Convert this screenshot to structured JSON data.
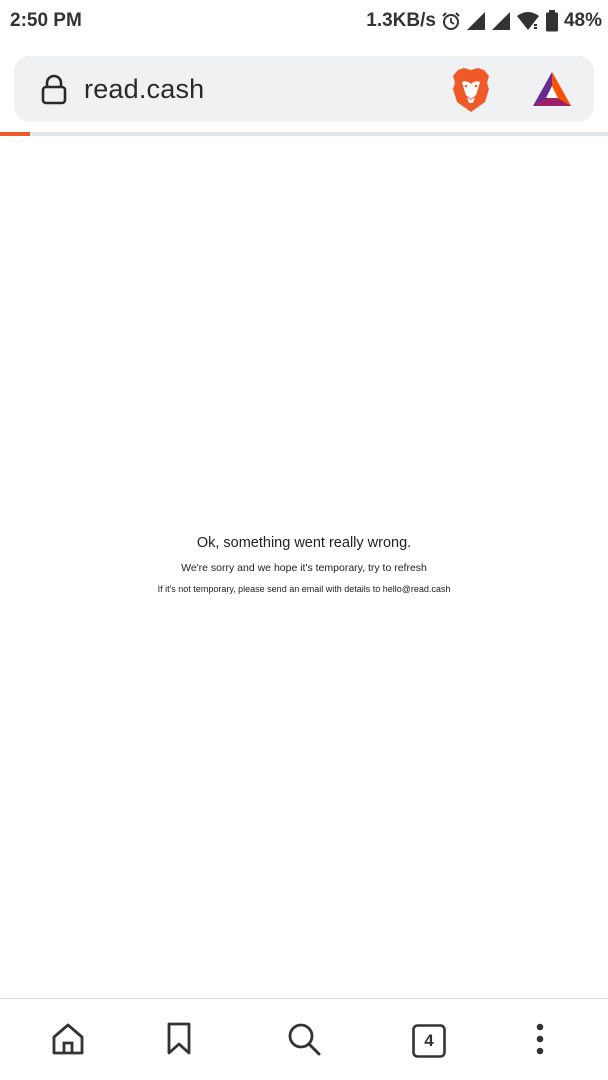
{
  "status_bar": {
    "time": "2:50 PM",
    "net_speed": "1.3KB/s",
    "battery": "48%",
    "icons": [
      "alarm-icon",
      "signal-icon",
      "signal-icon",
      "wifi-icon",
      "battery-icon"
    ]
  },
  "url_bar": {
    "url": "read.cash",
    "icons": [
      "lock-icon",
      "brave-shields-icon",
      "bat-rewards-icon"
    ]
  },
  "load_progress": 0.05,
  "error": {
    "title": "Ok, something went really wrong.",
    "line1": "We're sorry and we hope it's temporary, try to refresh",
    "line2": "If it's not temporary, please send an email with details to hello@read.cash"
  },
  "toolbar": {
    "tab_count": "4",
    "icons": [
      "home-icon",
      "bookmark-icon",
      "search-icon",
      "tabs-icon",
      "menu-icon"
    ]
  },
  "colors": {
    "brave_orange": "#f05a28",
    "url_bar_bg": "#eff1f3"
  }
}
